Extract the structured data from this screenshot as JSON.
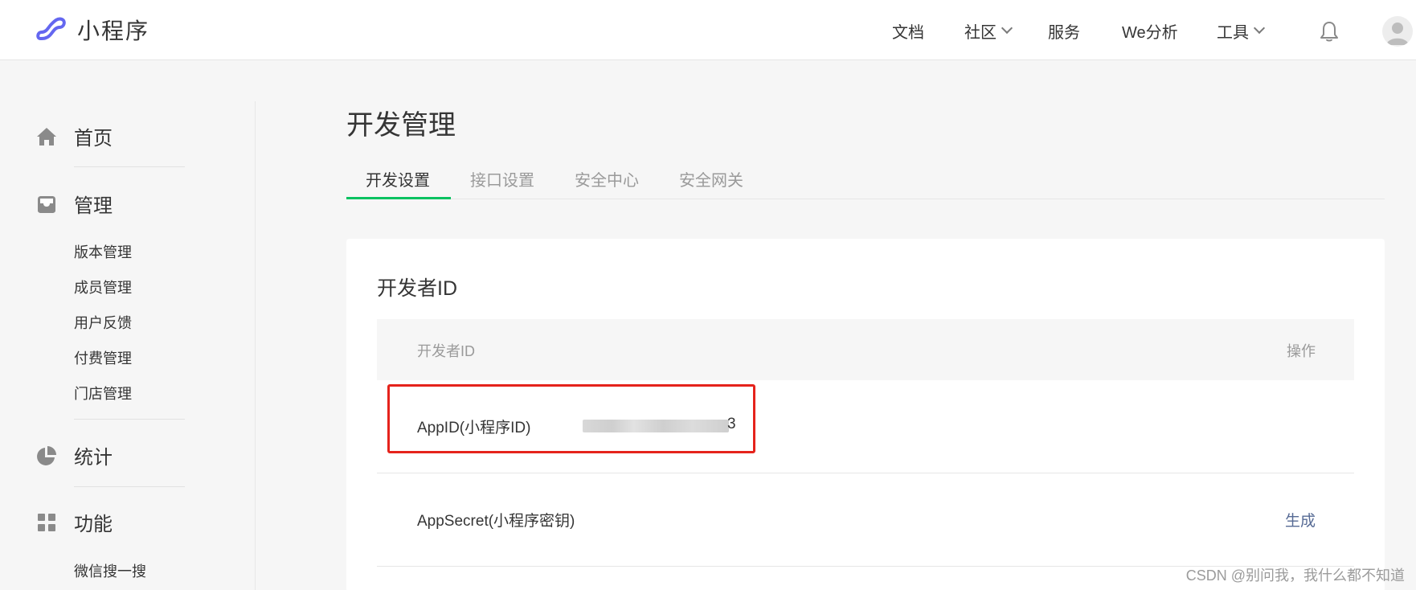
{
  "header": {
    "logo_text": "小程序",
    "nav": [
      {
        "label": "文档",
        "has_dropdown": false
      },
      {
        "label": "社区",
        "has_dropdown": true
      },
      {
        "label": "服务",
        "has_dropdown": false
      },
      {
        "label": "We分析",
        "has_dropdown": false
      },
      {
        "label": "工具",
        "has_dropdown": true
      }
    ],
    "icons": {
      "bell": "bell-icon",
      "avatar": "avatar"
    }
  },
  "sidebar": {
    "items": [
      {
        "label": "首页",
        "icon": "home-icon"
      },
      {
        "label": "管理",
        "icon": "inbox-icon"
      },
      {
        "label": "统计",
        "icon": "pie-chart-icon"
      },
      {
        "label": "功能",
        "icon": "grid-icon"
      }
    ],
    "management_sub": [
      "版本管理",
      "成员管理",
      "用户反馈",
      "付费管理",
      "门店管理"
    ],
    "feature_sub": [
      "微信搜一搜"
    ]
  },
  "main": {
    "title": "开发管理",
    "tabs": [
      {
        "label": "开发设置",
        "active": true
      },
      {
        "label": "接口设置",
        "active": false
      },
      {
        "label": "安全中心",
        "active": false
      },
      {
        "label": "安全网关",
        "active": false
      }
    ],
    "card": {
      "title": "开发者ID",
      "table": {
        "headers": [
          "开发者ID",
          "操作"
        ],
        "rows": [
          {
            "label": "AppID(小程序ID)",
            "value_tail": "3",
            "action": ""
          },
          {
            "label": "AppSecret(小程序密钥)",
            "action": "生成"
          }
        ]
      }
    }
  },
  "watermark": "CSDN @别问我，我什么都不知道",
  "colors": {
    "accent": "#07c160",
    "link": "#576b95",
    "highlight": "#e5231c",
    "logo": "#6467f0"
  }
}
